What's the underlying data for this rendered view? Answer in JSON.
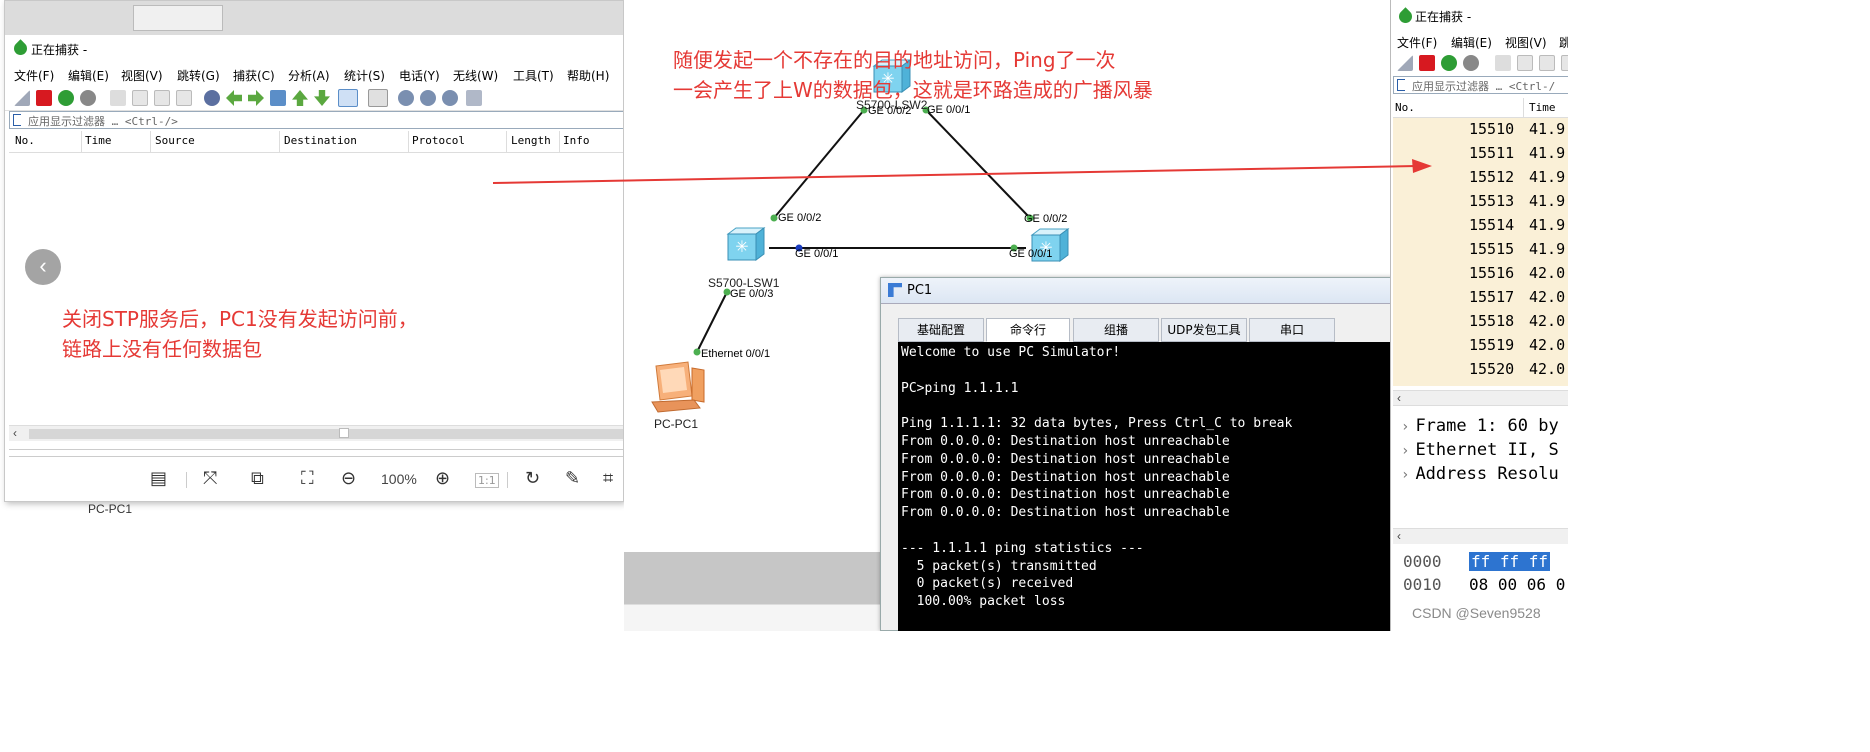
{
  "left_capture": {
    "title": "正在捕获 -",
    "menus": [
      "文件(F)",
      "编辑(E)",
      "视图(V)",
      "跳转(G)",
      "捕获(C)",
      "分析(A)",
      "统计(S)",
      "电话(Y)",
      "无线(W)",
      "工具(T)",
      "帮助(H)"
    ],
    "filter_placeholder": "应用显示过滤器 … <Ctrl-/>",
    "columns": [
      "No.",
      "Time",
      "Source",
      "Destination",
      "Protocol",
      "Length",
      "Info"
    ],
    "side_label": "PC-PC1"
  },
  "viewer": {
    "zoom": "100%",
    "ratio": "1:1"
  },
  "annotations": {
    "top": [
      "随便发起一个不存在的目的地址访问，Ping了一次",
      "一会产生了上W的数据包，这就是环路造成的广播风暴"
    ],
    "left": [
      "关闭STP服务后，PC1没有发起访问前，",
      "链路上没有任何数据包"
    ],
    "arrow_color": "#e53935"
  },
  "topology": {
    "devices": {
      "lsw2": "S5700-LSW2",
      "lsw1": "S5700-LSW1",
      "pc1": "PC-PC1"
    },
    "interfaces": {
      "lsw2_left": "GE 0/0/2",
      "lsw2_right": "GE 0/0/1",
      "lsw1_top": "GE 0/0/2",
      "lsw1_right": "GE 0/0/1",
      "lsw1_bottom": "GE 0/0/3",
      "lsw3_top": "GE 0/0/2",
      "lsw3_left": "GE 0/0/1",
      "pc_eth": "Ethernet 0/0/1"
    }
  },
  "pc1_window": {
    "title": "PC1",
    "tabs": [
      "基础配置",
      "命令行",
      "组播",
      "UDP发包工具",
      "串口"
    ],
    "active_tab": "命令行",
    "console": [
      "Welcome to use PC Simulator!",
      "",
      "PC>ping 1.1.1.1",
      "",
      "Ping 1.1.1.1: 32 data bytes, Press Ctrl_C to break",
      "From 0.0.0.0: Destination host unreachable",
      "From 0.0.0.0: Destination host unreachable",
      "From 0.0.0.0: Destination host unreachable",
      "From 0.0.0.0: Destination host unreachable",
      "From 0.0.0.0: Destination host unreachable",
      "",
      "--- 1.1.1.1 ping statistics ---",
      "  5 packet(s) transmitted",
      "  0 packet(s) received",
      "  100.00% packet loss"
    ]
  },
  "right_capture": {
    "title": "正在捕获 -",
    "menus": [
      "文件(F)",
      "编辑(E)",
      "视图(V)",
      "跳"
    ],
    "filter_placeholder": "应用显示过滤器 … <Ctrl-/",
    "columns": [
      "No.",
      "Time"
    ],
    "packets": [
      {
        "no": "15510",
        "time": "41.9"
      },
      {
        "no": "15511",
        "time": "41.9"
      },
      {
        "no": "15512",
        "time": "41.9"
      },
      {
        "no": "15513",
        "time": "41.9"
      },
      {
        "no": "15514",
        "time": "41.9"
      },
      {
        "no": "15515",
        "time": "41.9"
      },
      {
        "no": "15516",
        "time": "42.0"
      },
      {
        "no": "15517",
        "time": "42.0"
      },
      {
        "no": "15518",
        "time": "42.0"
      },
      {
        "no": "15519",
        "time": "42.0"
      },
      {
        "no": "15520",
        "time": "42.0"
      }
    ],
    "details": [
      "Frame 1: 60 by",
      "Ethernet II, S",
      "Address Resolu"
    ],
    "bytes": [
      {
        "offset": "0000",
        "hex": "ff ff ff"
      },
      {
        "offset": "0010",
        "hex": "08 00 06 0"
      }
    ]
  },
  "watermark": "CSDN @Seven9528"
}
